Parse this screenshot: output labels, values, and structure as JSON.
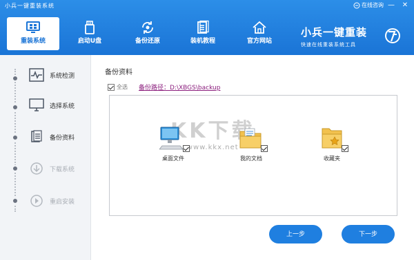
{
  "window": {
    "title": "小兵一键重装系统",
    "support_label": "在线咨询",
    "minimize_glyph": "—",
    "close_glyph": "✕"
  },
  "nav": {
    "tabs": [
      {
        "label": "重装系统",
        "icon": "monitor-icon",
        "active": true
      },
      {
        "label": "启动U盘",
        "icon": "usb-drive-icon",
        "active": false
      },
      {
        "label": "备份还原",
        "icon": "backup-restore-icon",
        "active": false
      },
      {
        "label": "装机教程",
        "icon": "tutorial-doc-icon",
        "active": false
      },
      {
        "label": "官方网站",
        "icon": "home-icon",
        "active": false
      }
    ]
  },
  "brand": {
    "title": "小兵一键重装",
    "slogan": "快速在线重装系统工具"
  },
  "steps": [
    {
      "label": "系统检测",
      "icon": "pulse-icon",
      "enabled": true
    },
    {
      "label": "选择系统",
      "icon": "monitor-icon",
      "enabled": true
    },
    {
      "label": "备份资料",
      "icon": "document-icon",
      "enabled": true
    },
    {
      "label": "下载系统",
      "icon": "download-icon",
      "enabled": false
    },
    {
      "label": "重启安装",
      "icon": "restart-icon",
      "enabled": false
    }
  ],
  "backup": {
    "section_title": "备份资料",
    "select_all_label": "全选",
    "select_all_checked": true,
    "path_text": "备份路径：D:\\XBGS\\backup",
    "items": [
      {
        "label": "桌面文件",
        "icon": "desktop-computer-icon",
        "checked": true
      },
      {
        "label": "我的文档",
        "icon": "documents-folder-icon",
        "checked": true
      },
      {
        "label": "收藏夹",
        "icon": "favorites-folder-icon",
        "checked": true
      }
    ]
  },
  "watermark": {
    "main": "KK下载",
    "url": "www.kkx.net"
  },
  "buttons": {
    "prev": "上一步",
    "next": "下一步"
  },
  "colors": {
    "accent": "#1f7fe0",
    "header": "#1a74d6",
    "sidebar_bg": "#f2f4f7",
    "path_link": "#8a1c7c"
  }
}
